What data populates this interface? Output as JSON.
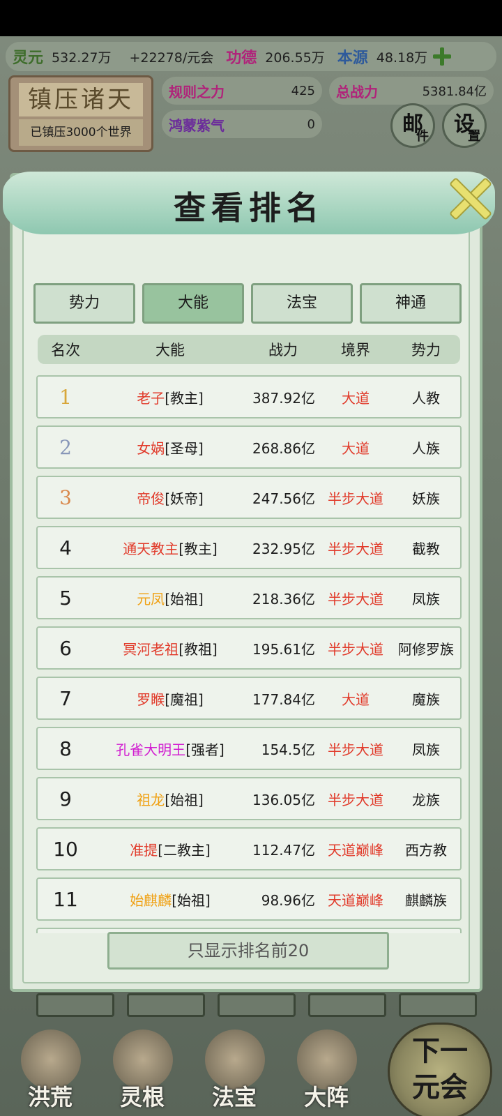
{
  "resources": [
    {
      "name": "灵元",
      "value": "532.27万",
      "color": "green"
    },
    {
      "name": "",
      "value": "+22278/元会",
      "color": "none"
    },
    {
      "name": "功德",
      "value": "206.55万",
      "color": "pink"
    },
    {
      "name": "本源",
      "value": "48.18万",
      "color": "blue"
    }
  ],
  "world": {
    "title": "镇压诸天",
    "subtitle": "已镇压3000个世界"
  },
  "stats": {
    "rule_power_label": "规则之力",
    "rule_power_value": "425",
    "total_power_label": "总战力",
    "total_power_value": "5381.84亿",
    "hongmeng_label": "鸿蒙紫气",
    "hongmeng_value": "0"
  },
  "buttons": {
    "mail_main": "邮",
    "mail_sub": "件",
    "settings_main": "设",
    "settings_sub": "置"
  },
  "dialog": {
    "title": "查看排名",
    "tabs": [
      "势力",
      "大能",
      "法宝",
      "神通"
    ],
    "active_tab": "大能",
    "columns": {
      "rank": "名次",
      "name": "大能",
      "power": "战力",
      "realm": "境界",
      "faction": "势力"
    },
    "rows": [
      {
        "rank": "1",
        "name": "老子",
        "title": "[教主]",
        "power": "387.92亿",
        "realm": "大道",
        "faction": "人教",
        "name_color": "red",
        "realm_color": "red",
        "rank_style": "gold"
      },
      {
        "rank": "2",
        "name": "女娲",
        "title": "[圣母]",
        "power": "268.86亿",
        "realm": "大道",
        "faction": "人族",
        "name_color": "red",
        "realm_color": "red",
        "rank_style": "silver"
      },
      {
        "rank": "3",
        "name": "帝俊",
        "title": "[妖帝]",
        "power": "247.56亿",
        "realm": "半步大道",
        "faction": "妖族",
        "name_color": "red",
        "realm_color": "red",
        "rank_style": "bronze"
      },
      {
        "rank": "4",
        "name": "通天教主",
        "title": "[教主]",
        "power": "232.95亿",
        "realm": "半步大道",
        "faction": "截教",
        "name_color": "red",
        "realm_color": "red",
        "rank_style": "plain"
      },
      {
        "rank": "5",
        "name": "元凤",
        "title": "[始祖]",
        "power": "218.36亿",
        "realm": "半步大道",
        "faction": "凤族",
        "name_color": "orange",
        "realm_color": "red",
        "rank_style": "plain"
      },
      {
        "rank": "6",
        "name": "冥河老祖",
        "title": "[教祖]",
        "power": "195.61亿",
        "realm": "半步大道",
        "faction": "阿修罗族",
        "name_color": "red",
        "realm_color": "red",
        "rank_style": "plain"
      },
      {
        "rank": "7",
        "name": "罗睺",
        "title": "[魔祖]",
        "power": "177.84亿",
        "realm": "大道",
        "faction": "魔族",
        "name_color": "red",
        "realm_color": "red",
        "rank_style": "plain"
      },
      {
        "rank": "8",
        "name": "孔雀大明王",
        "title": "[强者]",
        "power": "154.5亿",
        "realm": "半步大道",
        "faction": "凤族",
        "name_color": "magenta",
        "realm_color": "red",
        "rank_style": "plain"
      },
      {
        "rank": "9",
        "name": "祖龙",
        "title": "[始祖]",
        "power": "136.05亿",
        "realm": "半步大道",
        "faction": "龙族",
        "name_color": "orange",
        "realm_color": "red",
        "rank_style": "plain"
      },
      {
        "rank": "10",
        "name": "准提",
        "title": "[二教主]",
        "power": "112.47亿",
        "realm": "天道巅峰",
        "faction": "西方教",
        "name_color": "red",
        "realm_color": "red",
        "rank_style": "plain"
      },
      {
        "rank": "11",
        "name": "始麒麟",
        "title": "[始祖]",
        "power": "98.96亿",
        "realm": "天道巅峰",
        "faction": "麒麟族",
        "name_color": "orange",
        "realm_color": "red",
        "rank_style": "plain"
      }
    ],
    "footer_button": "只显示排名前20"
  },
  "bottom_nav": [
    "洪荒",
    "灵根",
    "法宝",
    "大阵"
  ],
  "next_era": {
    "line1": "下一",
    "line2": "元会"
  }
}
